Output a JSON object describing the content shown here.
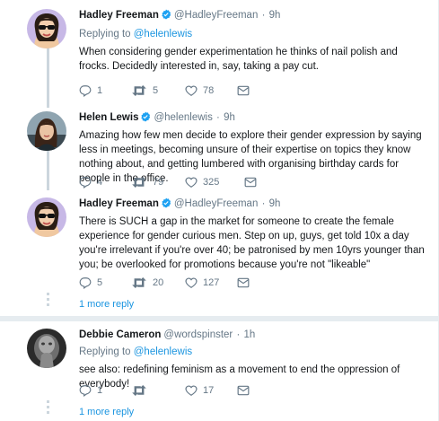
{
  "tweets": [
    {
      "name": "Hadley Freeman",
      "handle": "@HadleyFreeman",
      "sep": "·",
      "time": "9h",
      "replying_prefix": "Replying to",
      "replying_to": "@helenlewis",
      "text": "When considering gender experimentation he thinks of nail polish and frocks. Decidedly interested in, say, taking a pay cut.",
      "replies": "1",
      "retweets": "5",
      "likes": "78"
    },
    {
      "name": "Helen Lewis",
      "handle": "@helenlewis",
      "sep": "·",
      "time": "9h",
      "text": "Amazing how few men decide to explore their gender expression by saying less in meetings, becoming unsure of their expertise on topics they know nothing about, and getting lumbered with organising birthday cards for people in the office.",
      "replies": "4",
      "retweets": "79",
      "likes": "325"
    },
    {
      "name": "Hadley Freeman",
      "handle": "@HadleyFreeman",
      "sep": "·",
      "time": "9h",
      "text": "There is SUCH a gap in the market for someone to create the female experience for gender curious men. Step on up, guys, get told 10x a day you're irrelevant if you're over 40; be patronised by men 10yrs younger than you; be overlooked for promotions because you're not \"likeable\"",
      "replies": "5",
      "retweets": "20",
      "likes": "127"
    },
    {
      "name": "Debbie Cameron",
      "handle": "@wordspinster",
      "sep": "·",
      "time": "1h",
      "replying_prefix": "Replying to",
      "replying_to": "@helenlewis",
      "text": "see also: redefining feminism as a movement to end the oppression of everybody!",
      "replies": "1",
      "retweets": "",
      "likes": "17"
    }
  ],
  "more_replies_label": "1 more reply",
  "colors": {
    "link": "#1b95e0",
    "muted": "#657786",
    "text": "#14171a",
    "thread_line": "#ccd6dd",
    "verified": "#1da1f2"
  },
  "icons": [
    "reply-icon",
    "retweet-icon",
    "like-icon",
    "direct-message-icon",
    "verified-badge-icon"
  ]
}
